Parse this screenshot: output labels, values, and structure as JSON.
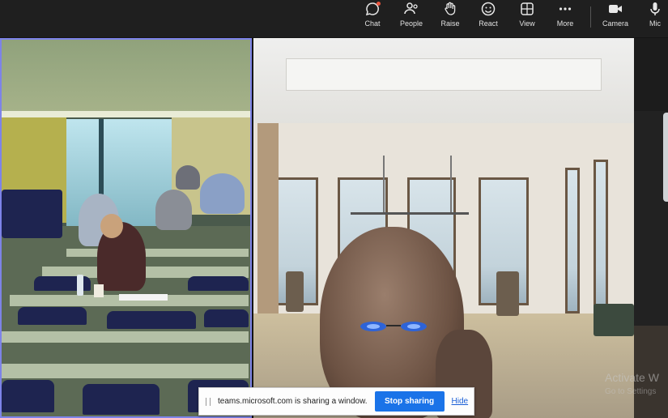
{
  "toolbar": {
    "items": [
      {
        "label": "Chat",
        "icon": "chat-icon"
      },
      {
        "label": "People",
        "icon": "people-icon"
      },
      {
        "label": "Raise",
        "icon": "raise-hand-icon"
      },
      {
        "label": "React",
        "icon": "react-icon"
      },
      {
        "label": "View",
        "icon": "view-icon"
      },
      {
        "label": "More",
        "icon": "more-icon"
      },
      {
        "label": "Camera",
        "icon": "camera-icon"
      },
      {
        "label": "Mic",
        "icon": "mic-icon"
      }
    ],
    "chat_badge_color": "#e8553e"
  },
  "tiles": {
    "active_border_color": "#7d83e8"
  },
  "watermark": {
    "title": "Activate W",
    "subtitle": "Go to Settings"
  },
  "sharebar": {
    "message": "teams.microsoft.com is sharing a window.",
    "stop_label": "Stop sharing",
    "hide_label": "Hide",
    "accent": "#1a73e8"
  }
}
